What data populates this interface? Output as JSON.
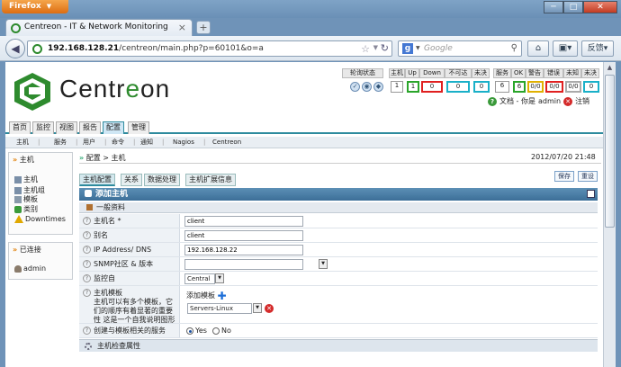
{
  "browser": {
    "app_button": "Firefox",
    "tab_title": "Centreon - IT & Network Monitoring",
    "url_host": "192.168.128.21",
    "url_path": "/centreon/main.php?p=60101&o=a",
    "search_placeholder": "Google",
    "feedback_label": "反馈"
  },
  "brand": {
    "name_pre": "Centr",
    "name_o": "e",
    "name_post": "on"
  },
  "status": {
    "poller_label": "轮询状态",
    "hosts": {
      "header": "主机",
      "value": "1"
    },
    "up": {
      "header": "Up",
      "value": "1"
    },
    "down": {
      "header": "Down",
      "value": "0"
    },
    "unreachable": {
      "header": "不可达",
      "value": "0"
    },
    "host_pending": {
      "header": "未决",
      "value": "0"
    },
    "services": {
      "header": "服务",
      "value": "6"
    },
    "ok": {
      "header": "OK",
      "value": "6"
    },
    "warning": {
      "header": "警告",
      "value": "0/0"
    },
    "critical": {
      "header": "错误",
      "value": "0/0"
    },
    "unknown": {
      "header": "未知",
      "value": "0/0"
    },
    "svc_pending": {
      "header": "未决",
      "value": "0"
    }
  },
  "user_line": {
    "docs": "文档 - 你是",
    "user": "admin",
    "logout": "注销"
  },
  "main_menu": [
    "首页",
    "监控",
    "视图",
    "报告",
    "配置",
    "管理"
  ],
  "main_menu_active": 4,
  "sub_menu": [
    "主机",
    "服务",
    "用户",
    "命令",
    "通知",
    "Nagios",
    "Centreon"
  ],
  "sidebar": {
    "hosts_title": "主机",
    "hosts_items": [
      "主机",
      "主机组",
      "模板",
      "类别",
      "Downtimes"
    ],
    "online_title": "已连接",
    "online_user": "admin"
  },
  "breadcrumb": {
    "part1": "配置",
    "part2": "主机"
  },
  "datetime": "2012/07/20 21:48",
  "form_tabs": [
    "主机配置",
    "关系",
    "数据处理",
    "主机扩展信息"
  ],
  "buttons": {
    "save": "保存",
    "reset": "重设"
  },
  "form": {
    "title": "添加主机",
    "section_general": "一般资料",
    "host_name_label": "主机名 *",
    "host_name_value": "client",
    "alias_label": "别名",
    "alias_value": "client",
    "ip_label": "IP Address/ DNS",
    "ip_value": "192.168.128.22",
    "snmp_label": "SNMP社区 & 版本",
    "snmp_value": "",
    "monitored_from_label": "监控自",
    "monitored_from_value": "Central",
    "templates_label": "主机模板",
    "templates_help": "主机可以有多个模板，它们的顺序有着显著的重要性 这是一个自我说明图形",
    "add_template_label": "添加模板",
    "template_value": "Servers-Linux",
    "create_services_label": "创建与模板相关的服务",
    "yes": "Yes",
    "no": "No",
    "section_check": "主机检查属性"
  },
  "colors": {
    "accent": "#2e8b9e",
    "brand_green": "#2e8b2e",
    "header_blue": "#3c6f98"
  }
}
